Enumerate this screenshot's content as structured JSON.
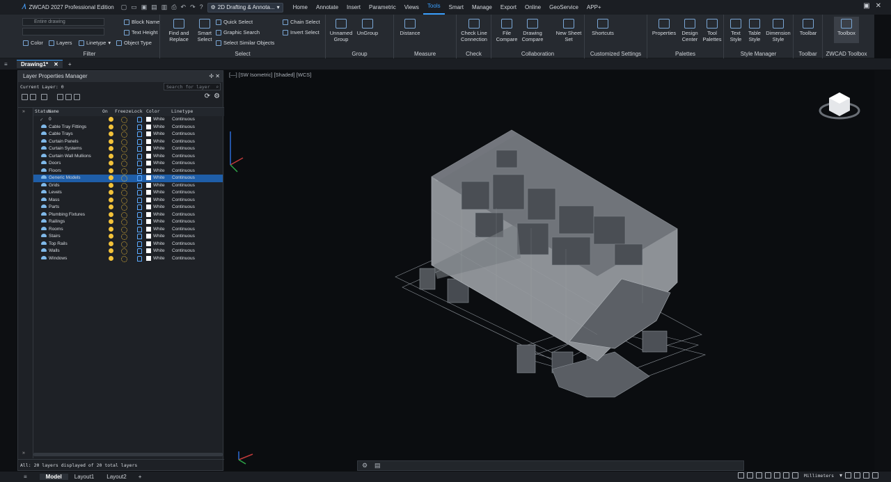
{
  "title": {
    "app": "ZWCAD 2027 Professional Edition",
    "workspace": "2D Drafting & Annota..."
  },
  "menu": [
    "Home",
    "Annotate",
    "Insert",
    "Parametric",
    "Views",
    "Tools",
    "Smart",
    "Manage",
    "Export",
    "Online",
    "GeoService",
    "APP+"
  ],
  "menu_active": "Tools",
  "ribbon": {
    "filter": {
      "combo1": "Entire drawing",
      "block_name": "Block Name",
      "text_height": "Text Height",
      "color": "Color",
      "layers": "Layers",
      "linetype": "Linetype",
      "object_type": "Object Type",
      "title": "Filter"
    },
    "select": {
      "find": "Find and Replace",
      "smart": "Smart Select",
      "quick": "Quick Select",
      "graphic": "Graphic Search",
      "similar": "Select Similar Objects",
      "chain": "Chain Select",
      "invert": "Invert Select",
      "title": "Select"
    },
    "group": {
      "unnamed": "Unnamed Group",
      "ungroup": "UnGroup",
      "title": "Group"
    },
    "measure": {
      "distance": "Distance",
      "title": "Measure"
    },
    "check": {
      "check_line": "Check Line Connection",
      "title": "Check"
    },
    "collaboration": {
      "file_compare": "File Compare",
      "drawing_compare": "Drawing Compare",
      "new_sheet": "New Sheet Set",
      "title": "Collaboration"
    },
    "customized": {
      "shortcuts": "Shortcuts",
      "title": "Customized Settings"
    },
    "palettes": {
      "properties": "Properties",
      "design_center": "Design Center",
      "tool_palettes": "Tool Palettes",
      "title": "Palettes"
    },
    "style": {
      "text": "Text Style",
      "table": "Table Style",
      "dimension": "Dimension Style",
      "title": "Style Manager"
    },
    "toolbar": {
      "label": "Toolbar",
      "title": "Toolbar"
    },
    "toolbox": {
      "label": "Toolbox",
      "title": "ZWCAD Toolbox"
    }
  },
  "file_tab": "Drawing1*",
  "lpm": {
    "title": "Layer Properties Manager",
    "current": "Current Layer: 0",
    "search_placeholder": "Search for layer",
    "columns": {
      "status": "Status",
      "name": "Name",
      "on": "On",
      "freeze": "Freeze",
      "lock": "Lock",
      "color": "Color",
      "linetype": "Linetype"
    },
    "layers": [
      {
        "name": "0",
        "color": "White",
        "linetype": "Continuous"
      },
      {
        "name": "Cable Tray Fittings",
        "color": "White",
        "linetype": "Continuous"
      },
      {
        "name": "Cable Trays",
        "color": "White",
        "linetype": "Continuous"
      },
      {
        "name": "Curtain Panels",
        "color": "White",
        "linetype": "Continuous"
      },
      {
        "name": "Curtain Systems",
        "color": "White",
        "linetype": "Continuous"
      },
      {
        "name": "Curtain Wall Mullions",
        "color": "White",
        "linetype": "Continuous"
      },
      {
        "name": "Doors",
        "color": "White",
        "linetype": "Continuous"
      },
      {
        "name": "Floors",
        "color": "White",
        "linetype": "Continuous"
      },
      {
        "name": "Generic Models",
        "color": "White",
        "linetype": "Continuous"
      },
      {
        "name": "Grids",
        "color": "White",
        "linetype": "Continuous"
      },
      {
        "name": "Levels",
        "color": "White",
        "linetype": "Continuous"
      },
      {
        "name": "Mass",
        "color": "White",
        "linetype": "Continuous"
      },
      {
        "name": "Parts",
        "color": "White",
        "linetype": "Continuous"
      },
      {
        "name": "Plumbing Fixtures",
        "color": "White",
        "linetype": "Continuous"
      },
      {
        "name": "Railings",
        "color": "White",
        "linetype": "Continuous"
      },
      {
        "name": "Rooms",
        "color": "White",
        "linetype": "Continuous"
      },
      {
        "name": "Stairs",
        "color": "White",
        "linetype": "Continuous"
      },
      {
        "name": "Top Rails",
        "color": "White",
        "linetype": "Continuous"
      },
      {
        "name": "Walls",
        "color": "White",
        "linetype": "Continuous"
      },
      {
        "name": "Windows",
        "color": "White",
        "linetype": "Continuous"
      }
    ],
    "selected": "Generic Models",
    "status": "All: 20 layers displayed of 20 total layers"
  },
  "viewport_label": "[—] [SW Isometric] [Shaded] [WCS]",
  "layout_tabs": [
    "Model",
    "Layout1",
    "Layout2"
  ],
  "units": "Millimeters"
}
